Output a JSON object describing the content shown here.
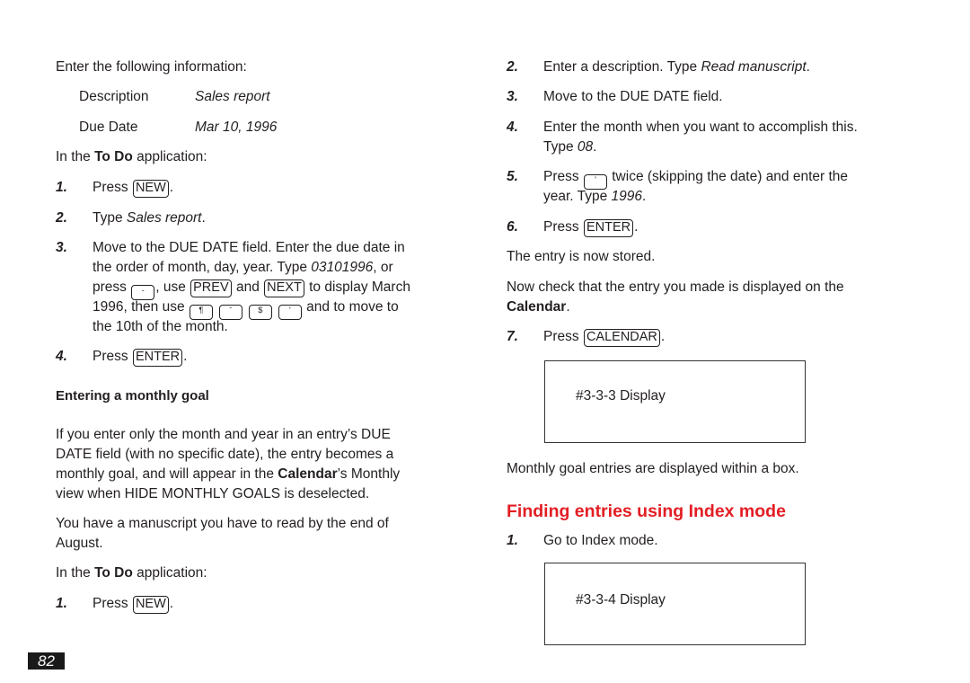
{
  "left": {
    "intro": "Enter the following information:",
    "fields": [
      {
        "label": "Description",
        "value": "Sales report"
      },
      {
        "label": "Due Date",
        "value": "Mar 10, 1996"
      }
    ],
    "app_line": {
      "pre": "In the ",
      "app": "To Do",
      "post": " application:"
    },
    "steps": [
      {
        "num": "1.",
        "pre": "Press ",
        "key": "NEW",
        "post": "."
      },
      {
        "num": "2.",
        "pre": "Type ",
        "italic": "Sales report",
        "post": "."
      },
      {
        "num": "3.",
        "lines": [
          "Move to the DUE DATE field. Enter the due date in",
          {
            "pre": "the order of month, day, year. Type ",
            "italic": "03101996",
            "post": ", or"
          },
          {
            "pre": "press ",
            "key_blank": "-",
            "mid1": ", use ",
            "key1": "PREV",
            "mid2": " and ",
            "key2": "NEXT",
            "post": " to display March"
          },
          {
            "pre": "1996, then use ",
            "keys": [
              "¶",
              "ˉ",
              "$",
              "'"
            ],
            "post": " and to move to"
          },
          "the 10th of the month."
        ]
      },
      {
        "num": "4.",
        "pre": "Press ",
        "key": "ENTER",
        "post": "."
      }
    ],
    "subheading": "Entering a monthly goal",
    "paragraph": {
      "line1": "If you enter only the month and year in an entry’s DUE",
      "line2": "DATE field (with no specific date), the entry becomes a",
      "line3_pre": "monthly goal, and will appear in the ",
      "line3_bold": "Calendar",
      "line3_post": "’s Monthly",
      "line4": "view when HIDE MONTHLY GOALS is deselected."
    },
    "manuscript": {
      "line1": "You have a manuscript you have to read by the end of",
      "line2": "August."
    },
    "app_line2": {
      "pre": "In the ",
      "app": "To Do",
      "post": " application:"
    },
    "step_final": {
      "num": "1.",
      "pre": "Press ",
      "key": "NEW",
      "post": "."
    }
  },
  "right": {
    "steps": [
      {
        "num": "2.",
        "pre": "Enter a description. Type ",
        "italic": "Read manuscript",
        "post": "."
      },
      {
        "num": "3.",
        "text": "Move to the DUE DATE field."
      },
      {
        "num": "4.",
        "line1": "Enter the month when you want to accomplish this.",
        "line2_pre": "Type ",
        "line2_italic": "08",
        "line2_post": "."
      },
      {
        "num": "5.",
        "pre": "Press ",
        "key": "'",
        "post": " twice (skipping the date) and enter the",
        "line2_pre": "year. Type ",
        "line2_italic": "1996",
        "line2_post": "."
      },
      {
        "num": "6.",
        "pre": "Press ",
        "key": "ENTER",
        "post": "."
      }
    ],
    "stored": "The entry is now stored.",
    "check": {
      "line1": "Now check that the entry you made is displayed on the",
      "bold": "Calendar",
      "post": "."
    },
    "step7": {
      "num": "7.",
      "pre": "Press ",
      "key": "CALENDAR",
      "post": "."
    },
    "display1": "#3-3-3 Display",
    "monthly_note": "Monthly goal entries are displayed within a box.",
    "heading": "Finding entries using Index mode",
    "heading_color": "#e31e24",
    "index_step": {
      "num": "1.",
      "text": "Go to Index mode."
    },
    "display2": "#3-3-4 Display"
  },
  "page_number": "82"
}
